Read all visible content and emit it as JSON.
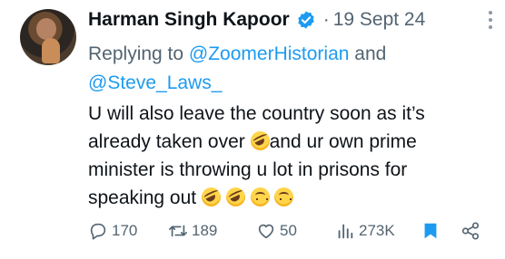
{
  "author": {
    "name": "Harman Singh Kapoor",
    "date": "19 Sept 24",
    "separator": "·"
  },
  "reply": {
    "prefix": "Replying to ",
    "mention_1": "@ZoomerHistorian",
    "joiner": " and",
    "mention_2": "@Steve_Laws_"
  },
  "tweet": {
    "line_1": "U will also leave the country soon as it’s",
    "line_2a": "already taken over ",
    "line_2b": "and ur own prime",
    "line_3": "minister is throwing u lot in prisons for",
    "line_4": "speaking out "
  },
  "stats": {
    "replies": "170",
    "reposts": "189",
    "likes": "50",
    "views": "273K"
  },
  "colors": {
    "accent": "#1d9bf0",
    "muted": "#536471",
    "text": "#0f1419"
  },
  "icons": [
    "verified-badge-icon",
    "more-icon",
    "reply-icon",
    "repost-icon",
    "like-icon",
    "views-icon",
    "bookmark-icon",
    "share-icon"
  ]
}
